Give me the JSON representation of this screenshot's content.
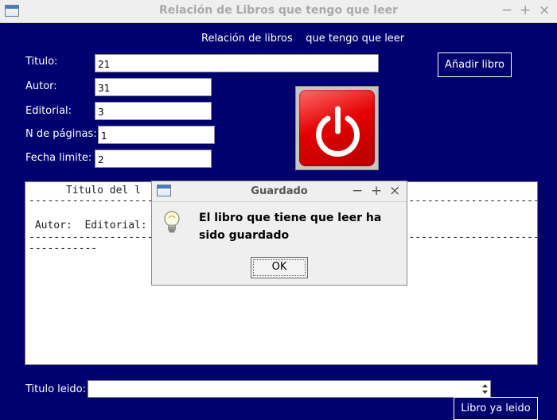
{
  "window": {
    "title": "Relación de Libros que tengo que leer",
    "controls": [
      "−",
      "+",
      "×"
    ]
  },
  "header": {
    "text": "Relación de libros    que tengo que leer"
  },
  "form": {
    "titulo_label": "Titulo:",
    "titulo_value": "21",
    "autor_label": "Autor:",
    "autor_value": "31",
    "editorial_label": "Editorial:",
    "editorial_value": "3",
    "paginas_label": "N de páginas:",
    "paginas_value": "1",
    "fecha_label": "Fecha limite:",
    "fecha_value": "2"
  },
  "buttons": {
    "add_book": "Añadir libro",
    "book_read": "Libro ya leido"
  },
  "list_area": {
    "header_line": "      Titulo del l",
    "separator": "--------------------------------------------------------------------------------------------",
    "row_line": " Autor:  Editorial:",
    "separator2": "--------------------------------------------------------------------------------------------",
    "separator3": "-----------"
  },
  "read_section": {
    "label": "Titulo leido:",
    "value": ""
  },
  "dialog": {
    "title": "Guardado",
    "message": "El libro que tiene que leer ha sido guardado",
    "ok_label": "OK",
    "controls": [
      "−",
      "+",
      "×"
    ]
  },
  "colors": {
    "background": "#00006e",
    "power_button": "#e40000"
  },
  "icons": {
    "power": "power-icon",
    "info": "lightbulb-icon"
  }
}
